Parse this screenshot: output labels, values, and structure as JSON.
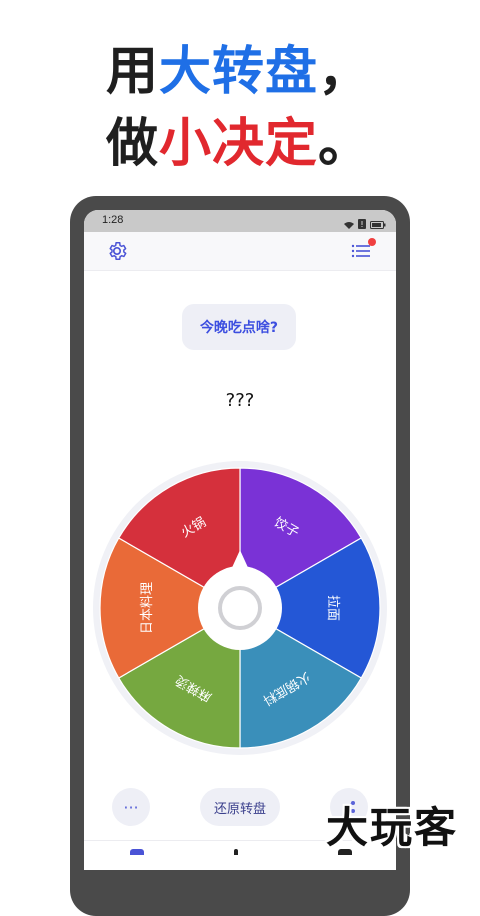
{
  "headline": {
    "line1": {
      "prefix": "用",
      "highlight": "大转盘",
      "suffix": "，"
    },
    "line2": {
      "prefix": "做",
      "highlight": "小决定",
      "suffix": "。"
    }
  },
  "status_bar": {
    "time": "1:28"
  },
  "app": {
    "question": "今晚吃点啥?",
    "result": "???",
    "reset_label": "还原转盘",
    "more_label": "···"
  },
  "wheel": {
    "segments": [
      {
        "label": "饺子",
        "color": "#7a32d6"
      },
      {
        "label": "拉面",
        "color": "#2457d6"
      },
      {
        "label": "火锅底料",
        "color": "#3a8fba"
      },
      {
        "label": "麻辣烫",
        "color": "#76a840"
      },
      {
        "label": "日本料理",
        "color": "#e96a38"
      },
      {
        "label": "火锅",
        "color": "#d5303c"
      }
    ]
  },
  "watermark": "大玩客",
  "colors": {
    "accent": "#3d4fe0",
    "blue": "#1f6fe6",
    "red": "#e1282e"
  }
}
